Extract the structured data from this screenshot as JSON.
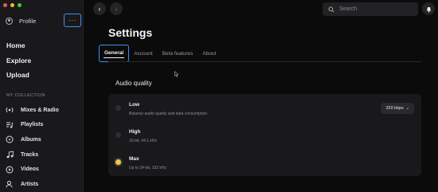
{
  "sidebar": {
    "profile_label": "Profile",
    "more_label": "···",
    "main_nav": [
      "Home",
      "Explore",
      "Upload"
    ],
    "section_label": "MY COLLECTION",
    "collection": [
      {
        "label": "Mixes & Radio",
        "icon": "radio-icon"
      },
      {
        "label": "Playlists",
        "icon": "playlist-icon"
      },
      {
        "label": "Albums",
        "icon": "album-icon"
      },
      {
        "label": "Tracks",
        "icon": "music-note-icon"
      },
      {
        "label": "Videos",
        "icon": "video-icon"
      },
      {
        "label": "Artists",
        "icon": "artist-icon"
      }
    ]
  },
  "topbar": {
    "search_placeholder": "Search",
    "back_glyph": "‹",
    "forward_glyph": "›"
  },
  "settings": {
    "title": "Settings",
    "tabs": [
      "General",
      "Account",
      "Beta features",
      "About"
    ],
    "active_tab": "General",
    "audio_section_title": "Audio quality",
    "quality_select": "320 kbps",
    "options": [
      {
        "title": "Low",
        "subtitle": "Balance audio quality and data consumption",
        "selected": false
      },
      {
        "title": "High",
        "subtitle": "16-bit, 44.1 kHz",
        "selected": false
      },
      {
        "title": "Max",
        "subtitle": "Up to 24-bit, 192 kHz",
        "selected": true
      }
    ]
  },
  "colors": {
    "accent": "#3d8ff3",
    "selected_radio": "#f6c343",
    "background": "#0b0b0c",
    "sidebar": "#19191b"
  }
}
